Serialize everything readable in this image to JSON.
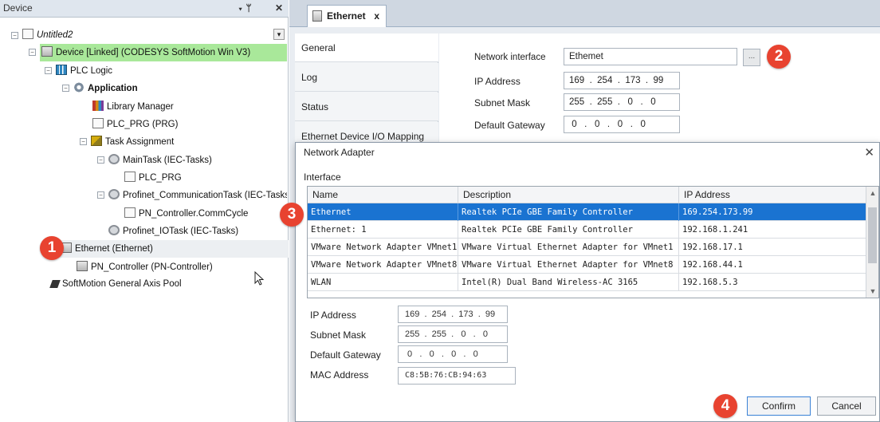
{
  "device_pane": {
    "title": "Device",
    "pin_glyph": "▾ ᛘ",
    "close_glyph": "✕",
    "dropdown_glyph": "▾",
    "tree": [
      {
        "label": "Untitled2",
        "icon": "project-icon"
      },
      {
        "label": "Device [Linked] (CODESYS SoftMotion Win V3)",
        "icon": "device-icon",
        "highlight": "#a9e89a"
      },
      {
        "label": "PLC Logic",
        "icon": "plc-logic-icon"
      },
      {
        "label": "Application",
        "icon": "application-gear-icon"
      },
      {
        "label": "Library Manager",
        "icon": "library-icon"
      },
      {
        "label": "PLC_PRG (PRG)",
        "icon": "program-icon"
      },
      {
        "label": "Task Assignment",
        "icon": "task-config-icon"
      },
      {
        "label": "MainTask (IEC-Tasks)",
        "icon": "task-icon"
      },
      {
        "label": "PLC_PRG",
        "icon": "program-call-icon"
      },
      {
        "label": "Profinet_CommunicationTask (IEC-Tasks)",
        "icon": "task-icon"
      },
      {
        "label": "PN_Controller.CommCycle",
        "icon": "program-call-icon"
      },
      {
        "label": "Profinet_IOTask (IEC-Tasks)",
        "icon": "task-icon"
      },
      {
        "label": "Ethernet (Ethernet)",
        "icon": "ethernet-device-icon"
      },
      {
        "label": "PN_Controller (PN-Controller)",
        "icon": "pn-controller-icon"
      },
      {
        "label": "SoftMotion General Axis Pool",
        "icon": "axis-pool-icon"
      }
    ]
  },
  "editor": {
    "tab_label": "Ethernet",
    "tab_close": "x",
    "side_tabs": [
      "General",
      "Log",
      "Status",
      "Ethernet Device I/O Mapping"
    ],
    "config": {
      "network_interface_label": "Network interface",
      "network_interface_value": "Ethemet",
      "browse_label": "...",
      "ip_label": "IP Address",
      "ip_value": "169  .  254  .  173  .  99",
      "subnet_label": "Subnet Mask",
      "subnet_value": "255  .  255  .   0   .   0",
      "gateway_label": "Default Gateway",
      "gateway_value": " 0   .   0   .   0   .   0"
    }
  },
  "dialog": {
    "title": "Network Adapter",
    "close_glyph": "✕",
    "interface_label": "Interface",
    "columns": [
      "Name",
      "Description",
      "IP Address"
    ],
    "rows": [
      {
        "name": "Ethernet",
        "description": "Realtek PCIe GBE Family Controller",
        "ip": "169.254.173.99",
        "selected": true
      },
      {
        "name": "Ethernet: 1",
        "description": "Realtek PCIe GBE Family Controller",
        "ip": "192.168.1.241",
        "selected": false
      },
      {
        "name": "VMware Network Adapter VMnet1",
        "description": "VMware Virtual Ethernet Adapter for VMnet1",
        "ip": "192.168.17.1",
        "selected": false
      },
      {
        "name": "VMware Network Adapter VMnet8",
        "description": "VMware Virtual Ethernet Adapter for VMnet8",
        "ip": "192.168.44.1",
        "selected": false
      },
      {
        "name": "WLAN",
        "description": "Intel(R) Dual Band Wireless-AC 3165",
        "ip": "192.168.5.3",
        "selected": false
      }
    ],
    "details": {
      "ip_label": "IP Address",
      "ip_value": "169  .  254  .  173  .  99",
      "subnet_label": "Subnet Mask",
      "subnet_value": "255  .  255  .   0   .   0",
      "gateway_label": "Default Gateway",
      "gateway_value": " 0   .   0   .   0   .   0",
      "mac_label": "MAC Address",
      "mac_value": "C8:5B:76:CB:94:63"
    },
    "confirm_label": "Confirm",
    "cancel_label": "Cancel"
  },
  "annotations": [
    "1",
    "2",
    "3",
    "4"
  ],
  "colors": {
    "badge": "#e84330",
    "selection": "#1a73d1",
    "device_highlight": "#a9e89a"
  }
}
